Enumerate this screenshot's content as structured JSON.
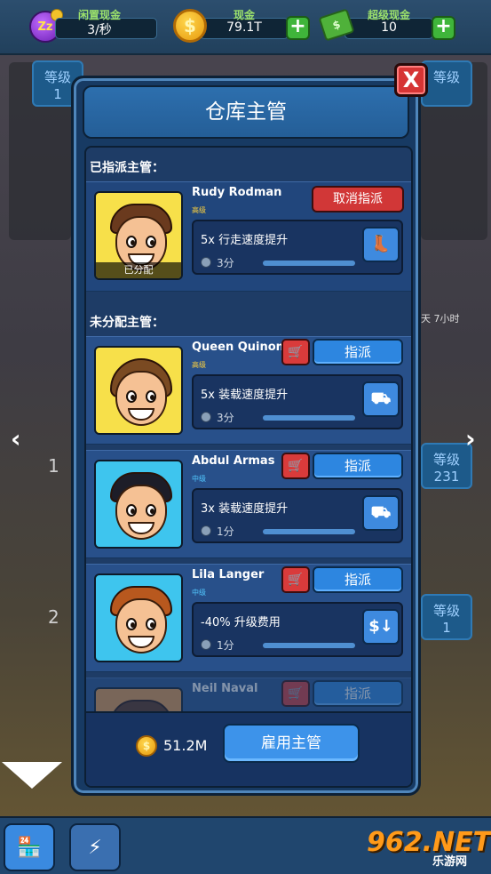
{
  "topbar": {
    "idle_cash": {
      "label": "闲置现金",
      "value": "3/秒",
      "icon": "zzz-icon"
    },
    "cash": {
      "label": "现金",
      "value": "79.1T",
      "icon": "coin-icon"
    },
    "super_cash": {
      "label": "超级现金",
      "value": "10",
      "icon": "cash-stack-icon"
    },
    "plus": "+"
  },
  "background": {
    "level_label": "等级",
    "level_value_a": "1",
    "level_value_b": "231",
    "level_value_c": "1",
    "timer_text": "天 7小时",
    "shaft_numbers": [
      "1",
      "2"
    ]
  },
  "modal": {
    "title": "仓库主管",
    "close": "X",
    "assigned_section": "已指派主管：",
    "unassigned_section": "未分配主管：",
    "assigned": {
      "name": "Rudy Rodman",
      "rank": "高级",
      "assigned_tag": "已分配",
      "unassign_label": "取消指派",
      "skill": "5x 行走速度提升",
      "time": "3分"
    },
    "unassigned": [
      {
        "name": "Queen Quinonez",
        "rank": "高级",
        "rank_type": "high",
        "skill": "5x 装载速度提升",
        "time": "3分",
        "assign": "指派",
        "cart": "🛒",
        "skill_icon": "cart-load-icon"
      },
      {
        "name": "Abdul Armas",
        "rank": "中级",
        "rank_type": "mid",
        "skill": "3x 装载速度提升",
        "time": "1分",
        "assign": "指派",
        "cart": "🛒",
        "skill_icon": "cart-load-icon"
      },
      {
        "name": "Lila Langer",
        "rank": "中级",
        "rank_type": "mid",
        "skill": "-40% 升级费用",
        "time": "1分",
        "assign": "指派",
        "cart": "🛒",
        "skill_icon": "dollar-down-icon"
      },
      {
        "name": "Neil Naval",
        "assign": "指派",
        "cart": "🛒"
      }
    ],
    "footer": {
      "cost": "51.2M",
      "hire_label": "雇用主管"
    }
  },
  "nav": {
    "left": "‹",
    "right": "›"
  },
  "watermark": {
    "big": "962.NET",
    "small": "乐游网"
  }
}
